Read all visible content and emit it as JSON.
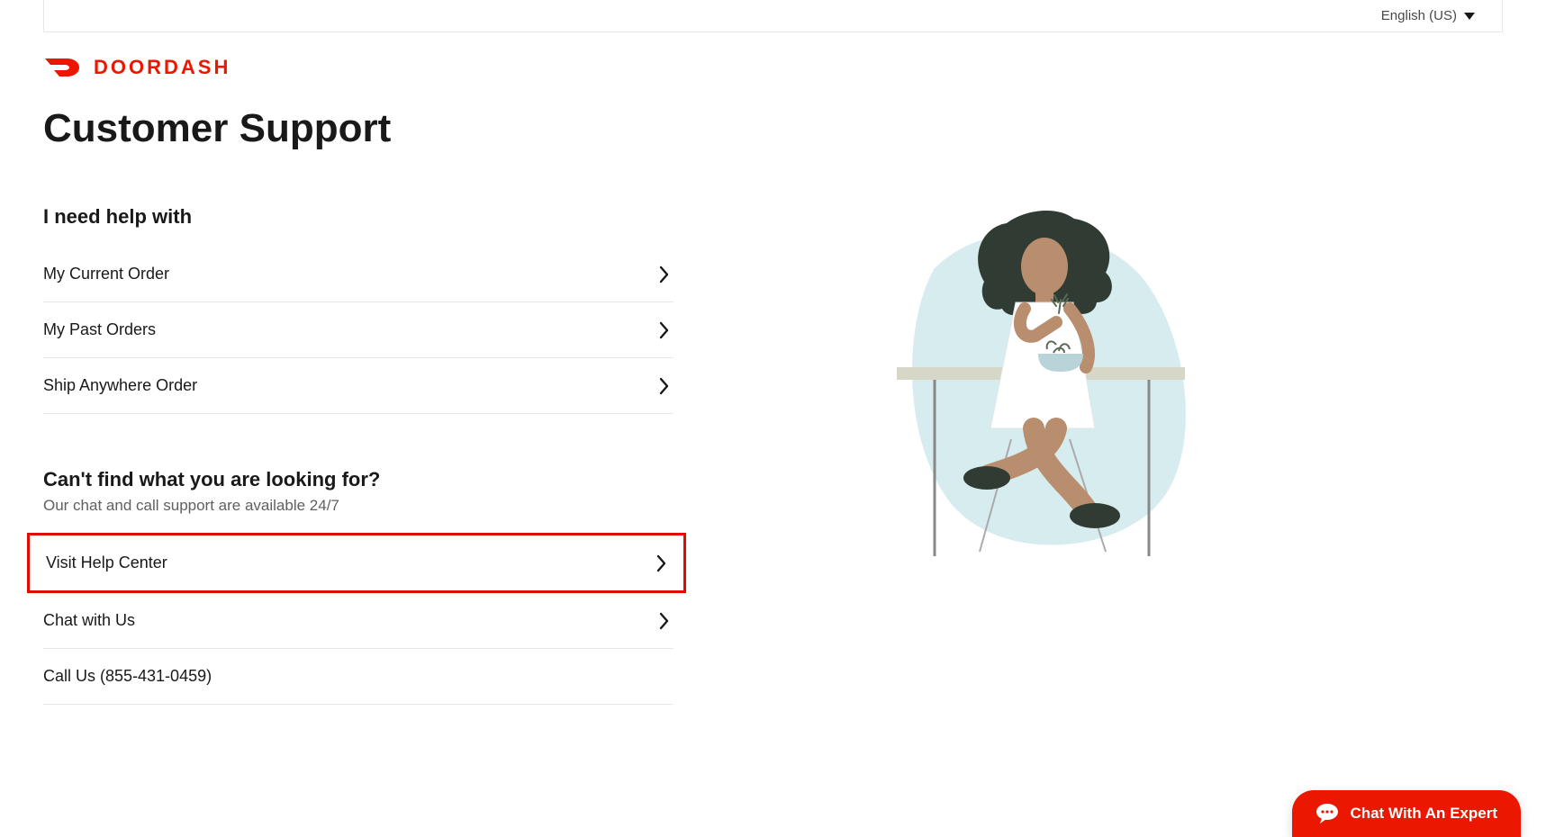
{
  "header": {
    "language_label": "English (US)",
    "brand_name": "DOORDASH"
  },
  "page": {
    "title": "Customer Support"
  },
  "help_section": {
    "heading": "I need help with",
    "items": [
      {
        "label": "My Current Order"
      },
      {
        "label": "My Past Orders"
      },
      {
        "label": "Ship Anywhere Order"
      }
    ]
  },
  "more_section": {
    "heading": "Can't find what you are looking for?",
    "subtext": "Our chat and call support are available 24/7",
    "items": [
      {
        "label": "Visit Help Center"
      },
      {
        "label": "Chat with Us"
      },
      {
        "label": "Call Us (855-431-0459)"
      }
    ]
  },
  "chat_widget": {
    "label": "Chat With An Expert"
  },
  "colors": {
    "brand": "#eb1700",
    "highlight_border": "#e10c00"
  }
}
